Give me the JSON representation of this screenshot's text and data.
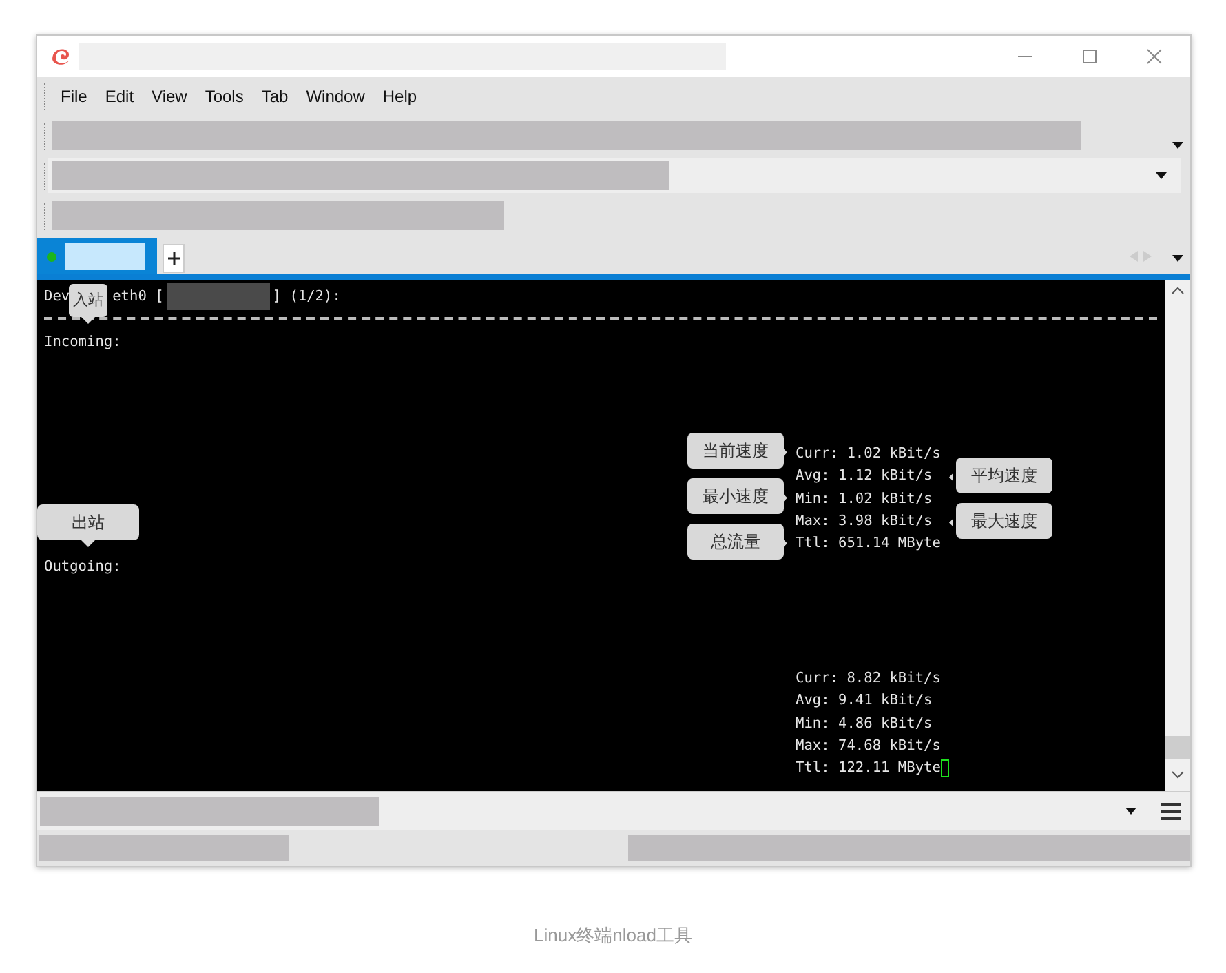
{
  "menu": [
    "File",
    "Edit",
    "View",
    "Tools",
    "Tab",
    "Window",
    "Help"
  ],
  "tabs": [
    {
      "selected": true
    }
  ],
  "terminal": {
    "header": {
      "prefix": "Dev",
      "device": "eth0 [",
      "suffix": "] (1/2):"
    },
    "sections": [
      {
        "label": "Incoming:",
        "stats": [
          "Curr: 1.02 kBit/s",
          "Avg: 1.12 kBit/s",
          "Min: 1.02 kBit/s",
          "Max: 3.98 kBit/s",
          "Ttl: 651.14 MByte"
        ]
      },
      {
        "label": "Outgoing:",
        "stats": [
          "Curr: 8.82 kBit/s",
          "Avg: 9.41 kBit/s",
          "Min: 4.86 kBit/s",
          "Max: 74.68 kBit/s",
          "Ttl: 122.11 MByte"
        ]
      }
    ],
    "cursor": true
  },
  "callouts": [
    {
      "text": "入站"
    },
    {
      "text": "出站"
    },
    {
      "text": "当前速度"
    },
    {
      "text": "最小速度"
    },
    {
      "text": "总流量"
    },
    {
      "text": "平均速度"
    },
    {
      "text": "最大速度"
    }
  ],
  "caption": "Linux终端nload工具"
}
